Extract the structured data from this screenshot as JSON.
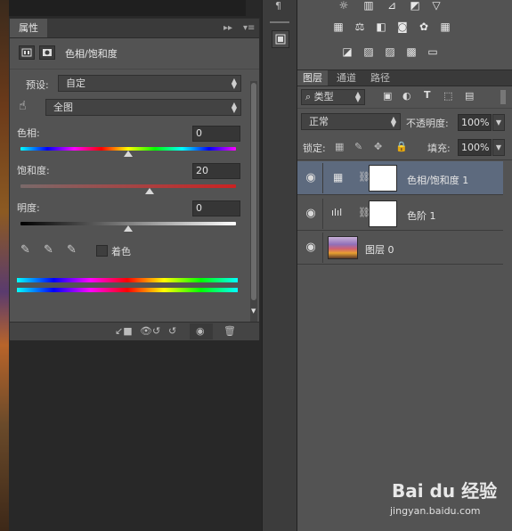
{
  "properties_panel": {
    "tab_label": "属性",
    "header_title": "色相/饱和度",
    "preset_label": "预设:",
    "preset_value": "自定",
    "channel_value": "全图",
    "hue": {
      "label": "色相:",
      "value": "0",
      "level": 0.5
    },
    "saturation": {
      "label": "饱和度:",
      "value": "20",
      "level": 0.6
    },
    "lightness": {
      "label": "明度:",
      "value": "0",
      "level": 0.5
    },
    "colorize_label": "着色",
    "colorize_checked": false
  },
  "layers_panel": {
    "tabs": [
      "图层",
      "通道",
      "路径"
    ],
    "active_tab": "图层",
    "filter_value": "类型",
    "blend_mode": "正常",
    "opacity_label": "不透明度:",
    "opacity_value": "100%",
    "lock_label": "锁定:",
    "fill_label": "填充:",
    "fill_value": "100%",
    "layers": [
      {
        "name": "色相/饱和度 1",
        "type": "adjustment",
        "selected": true
      },
      {
        "name": "色阶 1",
        "type": "adjustment",
        "selected": false
      },
      {
        "name": "图层 0",
        "type": "image",
        "selected": false
      }
    ]
  },
  "watermark": {
    "brand": "Bai du 经验",
    "url": "jingyan.baidu.com"
  },
  "colors": {
    "panel_bg": "#535353",
    "dark_bg": "#282828",
    "selected_row": "#5d6a7e"
  }
}
